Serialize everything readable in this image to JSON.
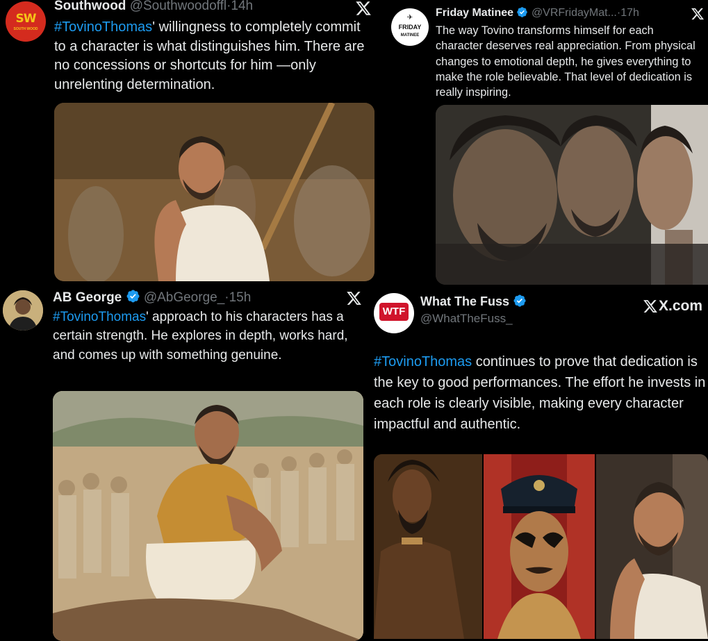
{
  "tweets": [
    {
      "name": "Southwood",
      "handle": "@Southwoodoffl",
      "time": "14h",
      "hashtag": "#TovinoThomas",
      "text": "' willingness to completely commit to a character is what distinguishes him. There are no concessions or shortcuts for him —only unrelenting determination.",
      "avatar_text": "SW",
      "avatar_subtext": "SOUTH WOOD",
      "verified": false
    },
    {
      "name": "Friday Matinee",
      "handle": "@VRFridayMat...",
      "time": "17h",
      "hashtag": "",
      "text": "The way Tovino transforms himself for each character deserves real appreciation. From physical changes to emotional depth, he gives everything to make the role believable. That level of dedication is really inspiring.",
      "avatar_text": "FRIDAY",
      "avatar_subtext": "MATINEE",
      "verified": true
    },
    {
      "name": "AB George",
      "handle": "@AbGeorge_",
      "time": "15h",
      "hashtag": "#TovinoThomas",
      "text": "' approach to his characters has a certain strength. He explores in depth, works hard, and comes up with something genuine.",
      "verified": true
    },
    {
      "name": "What The Fuss",
      "handle": "@WhatTheFuss_",
      "time": "",
      "hashtag": "#TovinoThomas",
      "text": " continues to prove that dedication is the key to good performances. The effort he invests in each role is clearly visible, making every character impactful and authentic.",
      "avatar_text": "WTF",
      "verified": true,
      "site_label": "X.com"
    }
  ],
  "separator": "·",
  "icons": {
    "x_logo": "x-logo-icon",
    "verified": "verified-badge-icon"
  },
  "colors": {
    "background": "#000000",
    "text": "#e7e9ea",
    "muted": "#71767b",
    "link": "#1d9bf0",
    "verified": "#1d9bf0"
  }
}
